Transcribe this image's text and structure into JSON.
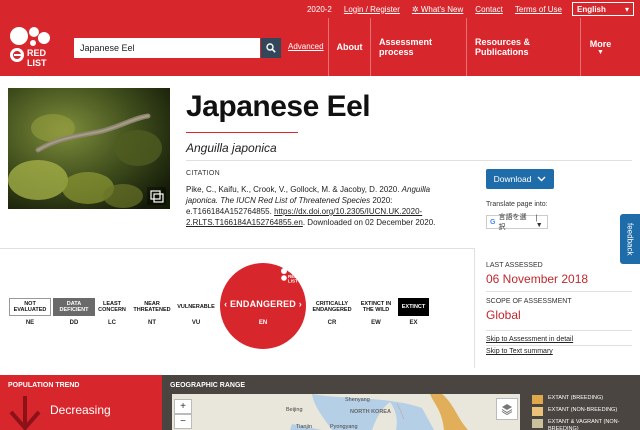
{
  "topbar": {
    "year": "2020-2",
    "login": "Login / Register",
    "whats_new": "What's New",
    "contact": "Contact",
    "terms": "Terms of Use",
    "language": "English"
  },
  "logo": {
    "line1": "RED",
    "line2": "LIST"
  },
  "search": {
    "value": "Japanese Eel",
    "advanced": "Advanced"
  },
  "nav": {
    "about": "About",
    "assessment": "Assessment process",
    "resources": "Resources & Publications",
    "more": "More"
  },
  "species": {
    "common_name": "Japanese Eel",
    "scientific_name": "Anguilla japonica"
  },
  "citation": {
    "label": "CITATION",
    "authors": "Pike, C., Kaifu, K., Crook, V., Gollock, M. & Jacoby, D. 2020.",
    "work_title": "Anguilla japonica. The IUCN Red List of Threatened Species",
    "year_id": "2020: e.T166184A152764855.",
    "doi": "https://dx.doi.org/10.2305/IUCN.UK.2020-2.RLTS.T166184A152764855.en",
    "downloaded": ". Downloaded on 02 December 2020."
  },
  "download_label": "Download",
  "translate": {
    "label": "Translate page into:",
    "select": "言語を選択"
  },
  "feedback": "feedback",
  "categories": [
    {
      "label": "NOT EVALUATED",
      "abbr": "NE"
    },
    {
      "label": "DATA DEFICIENT",
      "abbr": "DD"
    },
    {
      "label": "LEAST CONCERN",
      "abbr": "LC"
    },
    {
      "label": "NEAR THREATENED",
      "abbr": "NT"
    },
    {
      "label": "VULNERABLE",
      "abbr": "VU"
    },
    {
      "label": "ENDANGERED",
      "abbr": "EN"
    },
    {
      "label": "CRITICALLY ENDANGERED",
      "abbr": "CR"
    },
    {
      "label": "EXTINCT IN THE WILD",
      "abbr": "EW"
    },
    {
      "label": "EXTINCT",
      "abbr": "EX"
    }
  ],
  "assessment": {
    "last_assessed_label": "LAST ASSESSED",
    "last_assessed": "06 November 2018",
    "scope_label": "SCOPE OF ASSESSMENT",
    "scope": "Global",
    "link_detail": "Skip to Assessment in detail",
    "link_summary": "Skip to Text summary"
  },
  "trend": {
    "label": "POPULATION TREND",
    "value": "Decreasing"
  },
  "geo": {
    "label": "GEOGRAPHIC RANGE",
    "places": [
      "Shenyang",
      "Beijing",
      "Tianjin",
      "Pyongyang",
      "NORTH KOREA"
    ],
    "legend": [
      "EXTANT (BREEDING)",
      "EXTANT (NON-BREEDING)",
      "EXTANT & VAGRANT (NON-BREEDING)"
    ]
  },
  "colors": {
    "brand_red": "#d8262d",
    "nav_dark": "#33475b",
    "button_blue": "#1f6cab",
    "legend_breeding": "#e0a84a",
    "legend_nonbreeding": "#e9c37a",
    "legend_vagrant": "#c9c29a"
  }
}
